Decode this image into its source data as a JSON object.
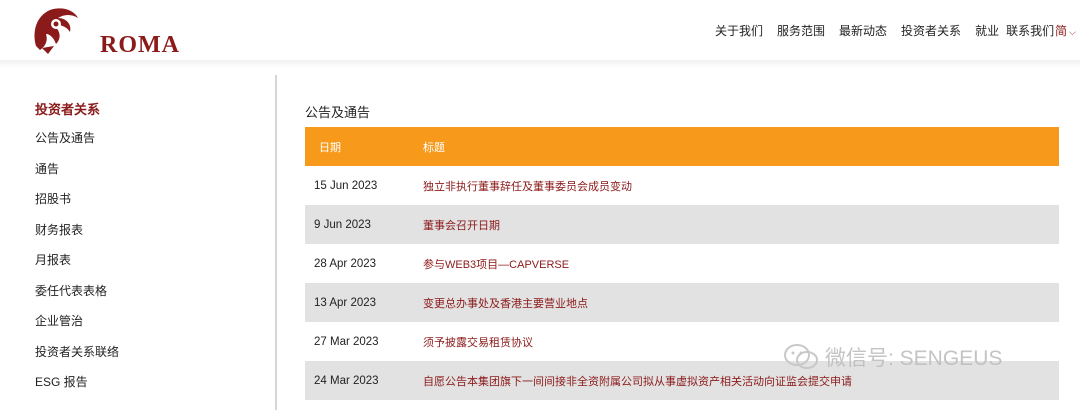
{
  "header": {
    "logo_text": "ROMA",
    "nav": [
      "关于我们",
      "服务范围",
      "最新动态",
      "投资者关系",
      "就业",
      "联系我们"
    ],
    "lang": "简",
    "lang_chevron": "⌵"
  },
  "sidebar": {
    "title": "投资者关系",
    "items": [
      "公告及通告",
      "通告",
      "招股书",
      "财务报表",
      "月报表",
      "委任代表表格",
      "企业管治",
      "投资者关系联络",
      "ESG 报告"
    ]
  },
  "content": {
    "title": "公告及通告",
    "headers": [
      "日期",
      "标题"
    ],
    "rows": [
      {
        "date": "15 Jun 2023",
        "title": "独立非执行董事辞任及董事委员会成员变动"
      },
      {
        "date": "9 Jun 2023",
        "title": "董事会召开日期"
      },
      {
        "date": "28 Apr 2023",
        "title": "参与WEB3项目—CAPVERSE"
      },
      {
        "date": "13 Apr 2023",
        "title": "变更总办事处及香港主要营业地点"
      },
      {
        "date": "27 Mar 2023",
        "title": "须予披露交易租赁协议"
      },
      {
        "date": "24 Mar 2023",
        "title": "自愿公告本集团旗下一间间接非全资附属公司拟从事虚拟资产相关活动向证监会提交申请"
      }
    ]
  },
  "watermark": "微信号: SENGEUS",
  "colors": {
    "brand": "#8b1a1a",
    "header_bg": "#f79a1b",
    "stripe": "#e2e2e2"
  }
}
